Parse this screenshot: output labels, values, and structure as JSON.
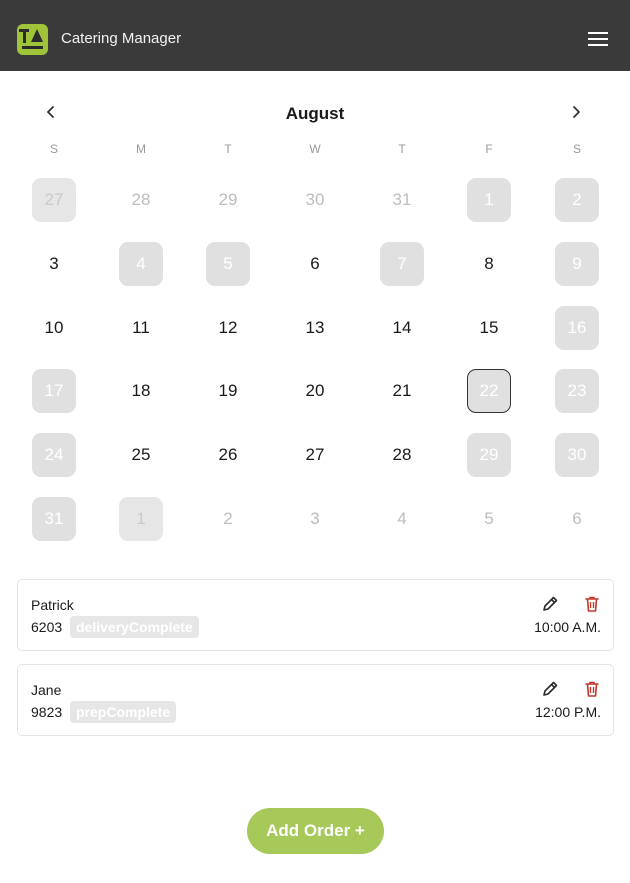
{
  "header": {
    "app_title": "Catering Manager",
    "logo_icon": "company-logo",
    "menu_icon": "hamburger-menu-icon"
  },
  "calendar": {
    "month": "August",
    "prev_icon": "chevron-left-icon",
    "next_icon": "chevron-right-icon",
    "weekdays": [
      "S",
      "M",
      "T",
      "W",
      "T",
      "F",
      "S"
    ],
    "selected_day": "22",
    "weeks": [
      [
        "27",
        "28",
        "29",
        "30",
        "31",
        "1",
        "2"
      ],
      [
        "3",
        "4",
        "5",
        "6",
        "7",
        "8",
        "9"
      ],
      [
        "10",
        "11",
        "12",
        "13",
        "14",
        "15",
        "16"
      ],
      [
        "17",
        "18",
        "19",
        "20",
        "21",
        "22",
        "23"
      ],
      [
        "24",
        "25",
        "26",
        "27",
        "28",
        "29",
        "30"
      ],
      [
        "31",
        "1",
        "2",
        "3",
        "4",
        "5",
        "6"
      ]
    ]
  },
  "orders": [
    {
      "name": "Patrick",
      "number": "6203",
      "status": "deliveryComplete",
      "time": "10:00 A.M."
    },
    {
      "name": "Jane",
      "number": "9823",
      "status": "prepComplete",
      "time": "12:00 P.M."
    }
  ],
  "actions": {
    "add_order": "Add Order +"
  },
  "colors": {
    "header_bg": "#3a3a3a",
    "accent": "#a6c95a",
    "delete": "#c0392b",
    "disabled_day_bg": "#e0e0e0"
  }
}
